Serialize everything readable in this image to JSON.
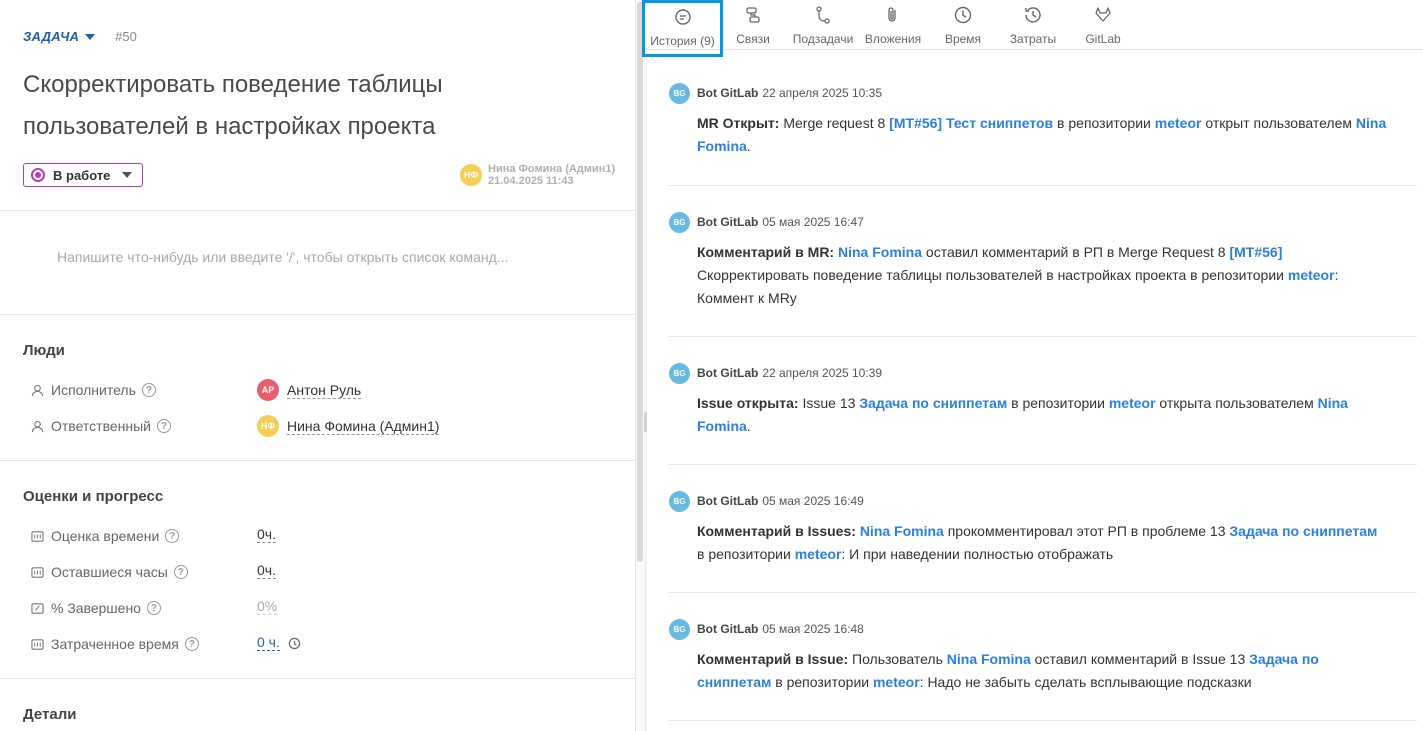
{
  "task": {
    "type_label": "ЗАДАЧА",
    "number": "#50",
    "title": "Скорректировать поведение таблицы пользователей в настройках проекта",
    "status": "В работе",
    "status_color": "#b33fb8",
    "author_initials": "НФ",
    "author_name": "Нина Фомина (Админ1)",
    "author_date": "21.04.2025 11:43"
  },
  "comment": {
    "placeholder": "Напишите что-нибудь или введите '/', чтобы открыть список команд..."
  },
  "people": {
    "title": "Люди",
    "executor_label": "Исполнитель",
    "executor_initials": "АР",
    "executor_name": "Антон Руль",
    "responsible_label": "Ответственный",
    "responsible_initials": "НФ",
    "responsible_name": "Нина Фомина (Админ1)"
  },
  "progress": {
    "title": "Оценки и прогресс",
    "estimate_label": "Оценка времени",
    "estimate_value": "0ч.",
    "remaining_label": "Оставшиеся часы",
    "remaining_value": "0ч.",
    "done_label": "% Завершено",
    "done_value": "0%",
    "spent_label": "Затраченное время",
    "spent_value": "0 ч."
  },
  "details": {
    "title": "Детали"
  },
  "tabs": [
    {
      "label": "История (9)",
      "icon": "history-icon"
    },
    {
      "label": "Связи",
      "icon": "links-icon"
    },
    {
      "label": "Подзадачи",
      "icon": "subtasks-icon"
    },
    {
      "label": "Вложения",
      "icon": "paperclip-icon"
    },
    {
      "label": "Время",
      "icon": "clock-icon"
    },
    {
      "label": "Затраты",
      "icon": "costs-icon"
    },
    {
      "label": "GitLab",
      "icon": "gitlab-icon"
    }
  ],
  "history": [
    {
      "initials": "BG",
      "author": "Bot GitLab",
      "date": "22 апреля 2025 10:35",
      "parts": [
        "MR Открыт:",
        " Merge request 8 ",
        "[MT#56] Тест сниппетов",
        " в репозитории ",
        "meteor",
        " открыт пользователем ",
        "Nina Fomina",
        "."
      ]
    },
    {
      "initials": "BG",
      "author": "Bot GitLab",
      "date": "05 мая 2025 16:47",
      "parts": [
        "Комментарий в MR:",
        " ",
        "Nina Fomina",
        " оставил комментарий в РП в Merge Request 8 ",
        "[MT#56]",
        " Скорректировать поведение таблицы пользователей в настройках проекта в репозитории ",
        "meteor",
        ": Коммент к MRу"
      ]
    },
    {
      "initials": "BG",
      "author": "Bot GitLab",
      "date": "22 апреля 2025 10:39",
      "parts": [
        "Issue открыта:",
        " Issue 13 ",
        "Задача по сниппетам",
        " в репозитории ",
        "meteor",
        " открыта пользователем ",
        "Nina Fomina",
        "."
      ]
    },
    {
      "initials": "BG",
      "author": "Bot GitLab",
      "date": "05 мая 2025 16:49",
      "parts": [
        "Комментарий в Issues:",
        " ",
        "Nina Fomina",
        " прокомментировал этот РП в проблеме 13 ",
        "Задача по сниппетам",
        " в репозитории ",
        "meteor",
        ": И при наведении полностью отображать"
      ]
    },
    {
      "initials": "BG",
      "author": "Bot GitLab",
      "date": "05 мая 2025 16:48",
      "parts": [
        "Комментарий в Issue:",
        " Пользователь ",
        "Nina Fomina",
        " оставил комментарий в Issue 13 ",
        "Задача по сниппетам",
        " в репозитории ",
        "meteor",
        ": Надо не забыть сделать всплывающие подсказки"
      ]
    }
  ],
  "colors": {
    "accent": "#0a96d8",
    "link": "#2b7fe0",
    "type_label": "#1f5ea8"
  }
}
